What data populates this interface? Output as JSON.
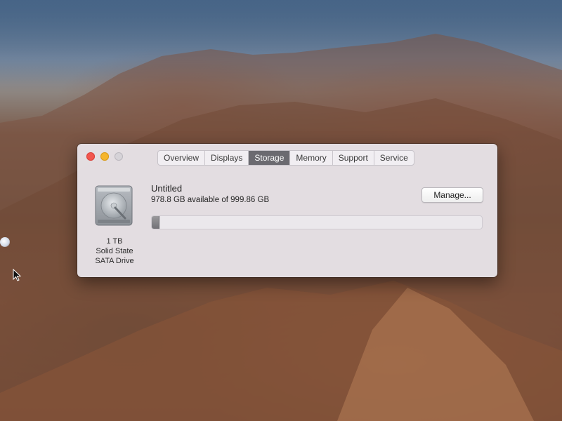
{
  "window": {
    "tabs": [
      {
        "label": "Overview",
        "active": false
      },
      {
        "label": "Displays",
        "active": false
      },
      {
        "label": "Storage",
        "active": true
      },
      {
        "label": "Memory",
        "active": false
      },
      {
        "label": "Support",
        "active": false
      },
      {
        "label": "Service",
        "active": false
      }
    ]
  },
  "storage": {
    "drive_icon": "internal-hard-drive-icon",
    "drive_caption": [
      "1 TB",
      "Solid State",
      "SATA Drive"
    ],
    "volume_name": "Untitled",
    "availability_text": "978.8 GB available of 999.86 GB",
    "manage_label": "Manage...",
    "used_fraction": 0.021
  },
  "colors": {
    "close": "#f2564e",
    "minimize": "#f5b52d",
    "zoom_disabled": "#d6d3d8",
    "active_tab": "#6b6a70"
  }
}
